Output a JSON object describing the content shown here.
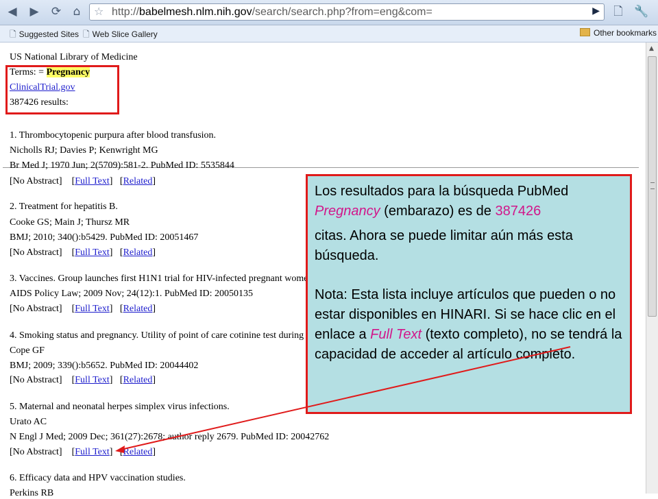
{
  "browser": {
    "url_host": "babelmesh.nlm.nih.gov",
    "url_prefix": "http://",
    "url_path": "/search/search.php?from=eng&com=",
    "bookmarks": [
      "Suggested Sites",
      "Web Slice Gallery"
    ],
    "other_bookmarks": "Other bookmarks"
  },
  "header": {
    "org": "US National Library of Medicine",
    "terms_label": "Terms: = ",
    "terms_value": "Pregnancy",
    "link": "ClinicalTrial.gov",
    "count": "387426 results:"
  },
  "results": [
    {
      "title": "1. Thrombocytopenic purpura after blood transfusion.",
      "authors": "Nicholls RJ; Davies P; Kenwright MG",
      "citation": "Br Med J; 1970 Jun; 2(5709):581-2. PubMed ID: 5535844"
    },
    {
      "title": "2. Treatment for hepatitis B.",
      "authors": "Cooke GS; Main J; Thursz MR",
      "citation": "BMJ; 2010; 340():b5429. PubMed ID: 20051467"
    },
    {
      "title": "3. Vaccines. Group launches first H1N1 trial for HIV-infected pregnant wome",
      "authors": "",
      "citation": "AIDS Policy Law; 2009 Nov; 24(12):1. PubMed ID: 20050135"
    },
    {
      "title": "4. Smoking status and pregnancy. Utility of point of care cotinine test during p",
      "authors": "Cope GF",
      "citation": "BMJ; 2009; 339():b5652. PubMed ID: 20044402"
    },
    {
      "title": "5. Maternal and neonatal herpes simplex virus infections.",
      "authors": "Urato AC",
      "citation": "N Engl J Med; 2009 Dec; 361(27):2678; author reply 2679. PubMed ID: 20042762"
    },
    {
      "title": "6. Efficacy data and HPV vaccination studies.",
      "authors": "Perkins RB",
      "citation": ""
    }
  ],
  "result_links": {
    "no_abstract": "[No Abstract]",
    "full_text": "Full Text",
    "related": "Related"
  },
  "callout": {
    "p1_a": "Los resultados para la búsqueda PubMed ",
    "p1_term": "Pregnancy",
    "p1_b": " (embarazo) es de ",
    "p1_count": "387426",
    "p1_c": "citas. Ahora se puede limitar aún más esta búsqueda.",
    "p2_a": "Nota: Esta lista incluye artículos que pueden o no estar disponibles en HINARI. Si se hace clic en el enlace a ",
    "p2_term": "Full Text",
    "p2_b": " (texto completo), no se tendrá la capacidad de acceder al artículo completo."
  },
  "colors": {
    "annotation_red": "#e01a1a",
    "callout_bg": "#b4dfe3",
    "highlight_pink": "#d1168a",
    "link_blue": "#1c1ccc"
  }
}
